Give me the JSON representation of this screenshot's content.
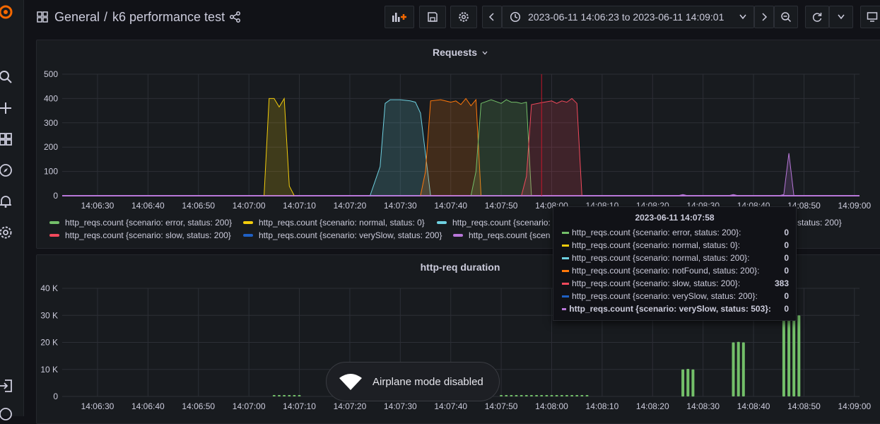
{
  "header": {
    "breadcrumb_folder": "General",
    "breadcrumb_sep": "/",
    "dashboard_title": "k6 performance test",
    "time_range": "2023-06-11 14:06:23 to 2023-06-11 14:09:01"
  },
  "colors": {
    "green": "#73bf69",
    "yellow": "#f2cc0c",
    "lightblue": "#8ab8ff",
    "cyan": "#6ed0e0",
    "orange": "#ff780a",
    "red": "#f2495c",
    "blue": "#1f60c4",
    "purple": "#b877d9",
    "grafana_orange": "#f46800"
  },
  "requests_panel": {
    "title": "Requests",
    "legend": [
      {
        "label": "http_reqs.count {scenario: error, status: 200}",
        "color": "#73bf69"
      },
      {
        "label": "http_reqs.count {scenario: normal, status: 0}",
        "color": "#f2cc0c"
      },
      {
        "label": "http_reqs.count {scenario:",
        "color": "#6ed0e0"
      },
      {
        "label": "status: 200}",
        "color": ""
      },
      {
        "label": "http_reqs.count {scenario: slow, status: 200}",
        "color": "#f2495c"
      },
      {
        "label": "http_reqs.count {scenario: verySlow, status: 200}",
        "color": "#1f60c4"
      },
      {
        "label": "http_reqs.count {scen",
        "color": "#b877d9"
      }
    ]
  },
  "duration_panel": {
    "title": "http-req duration"
  },
  "tooltip": {
    "time": "2023-06-11 14:07:58",
    "rows": [
      {
        "label": "http_reqs.count {scenario: error, status: 200}:",
        "value": "0",
        "color": "#73bf69"
      },
      {
        "label": "http_reqs.count {scenario: normal, status: 0}:",
        "value": "0",
        "color": "#f2cc0c"
      },
      {
        "label": "http_reqs.count {scenario: normal, status: 200}:",
        "value": "0",
        "color": "#6ed0e0"
      },
      {
        "label": "http_reqs.count {scenario: notFound, status: 200}:",
        "value": "0",
        "color": "#ff780a"
      },
      {
        "label": "http_reqs.count {scenario: slow, status: 200}:",
        "value": "383",
        "color": "#f2495c"
      },
      {
        "label": "http_reqs.count {scenario: verySlow, status: 200}:",
        "value": "0",
        "color": "#1f60c4"
      },
      {
        "label": "http_reqs.count {scenario: verySlow, status: 503}:",
        "value": "0",
        "color": "#b877d9"
      }
    ]
  },
  "toast": {
    "message": "Airplane mode disabled"
  },
  "chart_data": [
    {
      "type": "area",
      "title": "Requests",
      "x_tick_labels": [
        "14:06:30",
        "14:06:40",
        "14:06:50",
        "14:07:00",
        "14:07:10",
        "14:07:20",
        "14:07:30",
        "14:07:40",
        "14:07:50",
        "14:08:00",
        "14:08:10",
        "14:08:20",
        "14:08:30",
        "14:08:40",
        "14:08:50",
        "14:09:00"
      ],
      "y_tick_labels": [
        "0",
        "100",
        "200",
        "300",
        "400",
        "500"
      ],
      "xlim": [
        "14:06:23",
        "14:09:01"
      ],
      "ylim": [
        0,
        500
      ],
      "grid": true,
      "hover_time": "14:07:58",
      "series": [
        {
          "name": "http_reqs.count {scenario: normal, status: 0}",
          "color": "#f2cc0c",
          "x": [
            "14:07:03",
            "14:07:04",
            "14:07:05",
            "14:07:06",
            "14:07:07",
            "14:07:08",
            "14:07:09"
          ],
          "values": [
            0,
            400,
            400,
            365,
            400,
            40,
            0
          ]
        },
        {
          "name": "http_reqs.count {scenario: normal, status: 200}",
          "color": "#6ed0e0",
          "x": [
            "14:07:24",
            "14:07:26",
            "14:07:27",
            "14:07:28",
            "14:07:30",
            "14:07:32",
            "14:07:33",
            "14:07:34",
            "14:07:36"
          ],
          "values": [
            0,
            120,
            380,
            395,
            395,
            390,
            385,
            340,
            0
          ]
        },
        {
          "name": "http_reqs.count {scenario: notFound, status: 200}",
          "color": "#ff780a",
          "x": [
            "14:07:34",
            "14:07:35",
            "14:07:36",
            "14:07:38",
            "14:07:40",
            "14:07:41",
            "14:07:42",
            "14:07:43",
            "14:07:44",
            "14:07:45",
            "14:07:46"
          ],
          "values": [
            0,
            100,
            390,
            395,
            385,
            390,
            375,
            400,
            370,
            395,
            0
          ]
        },
        {
          "name": "http_reqs.count {scenario: error, status: 200}",
          "color": "#73bf69",
          "x": [
            "14:07:44",
            "14:07:45",
            "14:07:46",
            "14:07:48",
            "14:07:50",
            "14:07:51",
            "14:07:52",
            "14:07:53",
            "14:07:54",
            "14:07:55",
            "14:07:56"
          ],
          "values": [
            0,
            100,
            380,
            395,
            380,
            395,
            385,
            385,
            380,
            385,
            0
          ]
        },
        {
          "name": "http_reqs.count {scenario: slow, status: 200}",
          "color": "#f2495c",
          "x": [
            "14:07:54",
            "14:07:55",
            "14:07:56",
            "14:07:58",
            "14:08:00",
            "14:08:01",
            "14:08:02",
            "14:08:03",
            "14:08:04",
            "14:08:05",
            "14:08:06"
          ],
          "values": [
            0,
            80,
            375,
            383,
            390,
            380,
            390,
            385,
            400,
            380,
            0
          ]
        },
        {
          "name": "http_reqs.count {scenario: verySlow, status: 503}",
          "color": "#b877d9",
          "x": [
            "14:06:23",
            "14:08:25",
            "14:08:26",
            "14:08:27",
            "14:08:35",
            "14:08:36",
            "14:08:37",
            "14:08:45",
            "14:08:46",
            "14:08:47",
            "14:08:48",
            "14:09:01"
          ],
          "values": [
            0,
            0,
            5,
            0,
            0,
            5,
            0,
            0,
            5,
            175,
            0,
            0
          ]
        }
      ]
    },
    {
      "type": "bar",
      "title": "http-req duration",
      "x_tick_labels": [
        "14:06:30",
        "14:06:40",
        "14:06:50",
        "14:07:00",
        "14:07:10",
        "14:07:20",
        "14:07:30",
        "14:07:40",
        "14:07:50",
        "14:08:00",
        "14:08:10",
        "14:08:20",
        "14:08:30",
        "14:08:40",
        "14:08:50",
        "14:09:00"
      ],
      "y_tick_labels": [
        "0",
        "10 K",
        "20 K",
        "30 K",
        "40 K"
      ],
      "xlim": [
        "14:06:23",
        "14:09:01"
      ],
      "ylim": [
        0,
        40000
      ],
      "grid": true,
      "series": [
        {
          "color": "#73bf69",
          "x": [
            "14:07:05",
            "14:07:06",
            "14:07:07",
            "14:07:08",
            "14:07:09",
            "14:07:10",
            "14:07:50",
            "14:07:51",
            "14:07:52",
            "14:07:53",
            "14:07:54",
            "14:07:55",
            "14:07:56",
            "14:07:57",
            "14:07:58",
            "14:07:59",
            "14:08:00",
            "14:08:01",
            "14:08:02",
            "14:08:03",
            "14:08:04",
            "14:08:05",
            "14:08:06",
            "14:08:07",
            "14:08:26",
            "14:08:27",
            "14:08:28",
            "14:08:36",
            "14:08:37",
            "14:08:38",
            "14:08:46",
            "14:08:47",
            "14:08:48",
            "14:08:49"
          ],
          "values": [
            300,
            300,
            300,
            300,
            300,
            300,
            300,
            300,
            300,
            300,
            300,
            300,
            300,
            300,
            300,
            300,
            300,
            300,
            300,
            300,
            300,
            300,
            300,
            300,
            10000,
            10200,
            10000,
            20000,
            20200,
            20000,
            30000,
            30500,
            31000,
            30000
          ]
        }
      ]
    }
  ]
}
